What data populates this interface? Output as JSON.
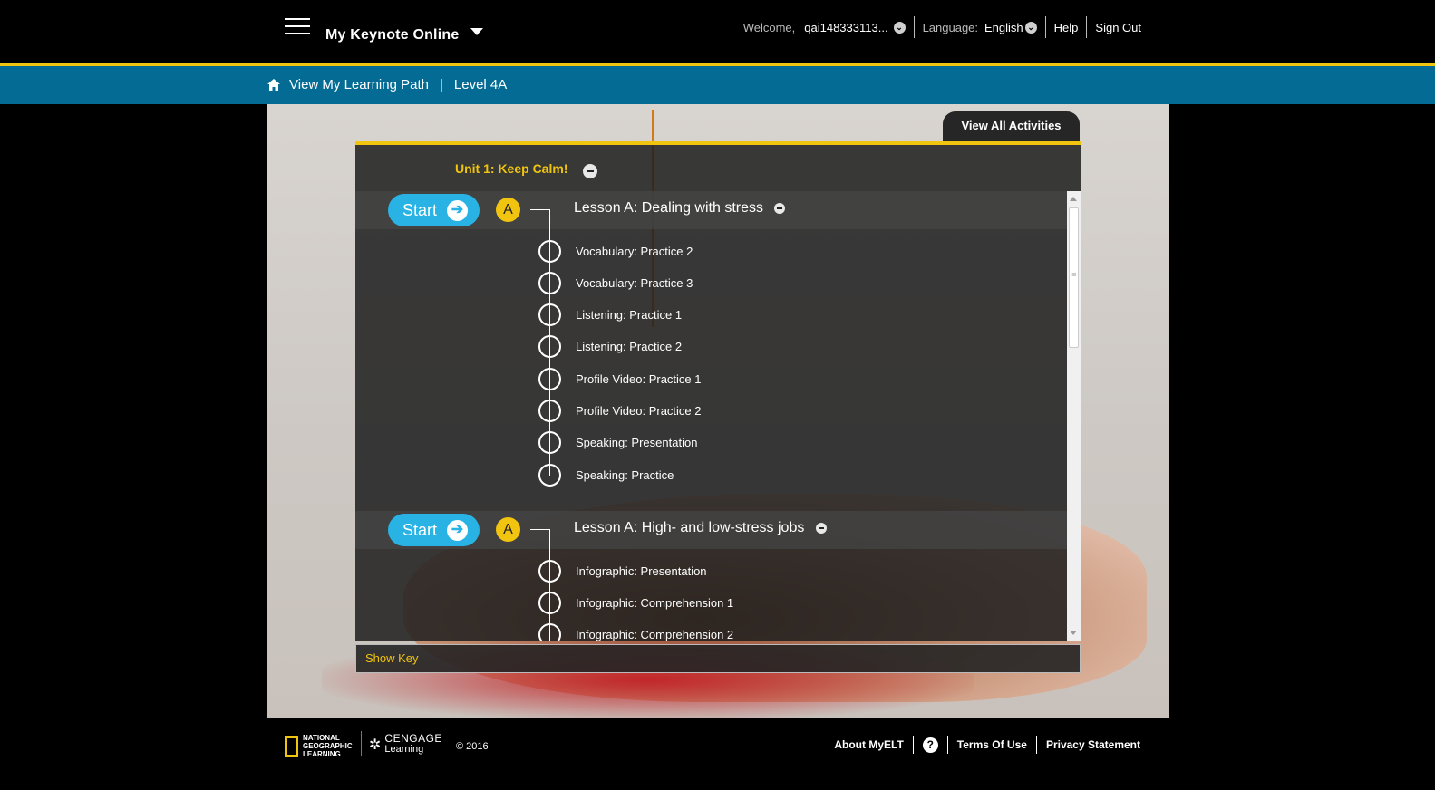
{
  "header": {
    "app_title": "My Keynote Online",
    "welcome_label": "Welcome,",
    "username": "qai148333113...",
    "language_label": "Language:",
    "language_value": "English",
    "help": "Help",
    "sign_out": "Sign Out"
  },
  "breadcrumb": {
    "home_link": "View My Learning Path",
    "separator": "|",
    "current": "Level 4A"
  },
  "view_all_activities": "View All Activities",
  "unit": {
    "title": "Unit 1: Keep Calm!"
  },
  "lessons": [
    {
      "start_label": "Start",
      "badge": "A",
      "title": "Lesson A: Dealing with stress",
      "activities": [
        "Vocabulary: Practice 2",
        "Vocabulary: Practice 3",
        "Listening: Practice 1",
        "Listening: Practice 2",
        "Profile Video: Practice 1",
        "Profile Video: Practice 2",
        "Speaking: Presentation",
        "Speaking: Practice"
      ]
    },
    {
      "start_label": "Start",
      "badge": "A",
      "title": "Lesson A: High- and low-stress jobs",
      "activities": [
        "Infographic: Presentation",
        "Infographic: Comprehension 1",
        "Infographic: Comprehension 2"
      ]
    }
  ],
  "show_key": "Show Key",
  "footer": {
    "ng_logo_lines": [
      "NATIONAL",
      "GEOGRAPHIC",
      "LEARNING"
    ],
    "cengage_name": "CENGAGE",
    "cengage_sub": "Learning",
    "copyright": "© 2016",
    "about": "About MyELT",
    "help_icon": "?",
    "terms": "Terms Of Use",
    "privacy": "Privacy Statement"
  },
  "colors": {
    "accent_gold": "#f1c40f",
    "breadcrumb_blue": "#046c94",
    "start_blue": "#29b3e5"
  }
}
